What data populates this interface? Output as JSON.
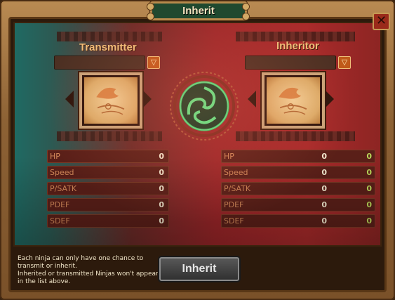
{
  "window": {
    "title": "Inherit",
    "close_label": "✕"
  },
  "transmitter": {
    "title": "Transmitter",
    "dropdown_icon": "▽",
    "stats": [
      {
        "label": "HP",
        "value": "0"
      },
      {
        "label": "Speed",
        "value": "0"
      },
      {
        "label": "P/SATK",
        "value": "0"
      },
      {
        "label": "PDEF",
        "value": "0"
      },
      {
        "label": "SDEF",
        "value": "0"
      }
    ]
  },
  "inheritor": {
    "title": "Inheritor",
    "dropdown_icon": "▽",
    "stats": [
      {
        "label": "HP",
        "value": "0",
        "bonus": "0"
      },
      {
        "label": "Speed",
        "value": "0",
        "bonus": "0"
      },
      {
        "label": "P/SATK",
        "value": "0",
        "bonus": "0"
      },
      {
        "label": "PDEF",
        "value": "0",
        "bonus": "0"
      },
      {
        "label": "SDEF",
        "value": "0",
        "bonus": "0"
      }
    ]
  },
  "footer": {
    "info_line1": "Each ninja can only have one chance to transmit or inherit.",
    "info_line2": "Inherited or transmitted Ninjas won't appear in the list above.",
    "inherit_button": "Inherit"
  },
  "colors": {
    "accent": "#f0c07a",
    "bonus": "#b9d85a",
    "panel_red": "#a82a2a",
    "panel_teal": "#1f6a63"
  },
  "icons": [
    "close-icon",
    "dropdown-icon",
    "swirl-emblem-icon",
    "arrow-left-icon",
    "arrow-right-icon"
  ]
}
